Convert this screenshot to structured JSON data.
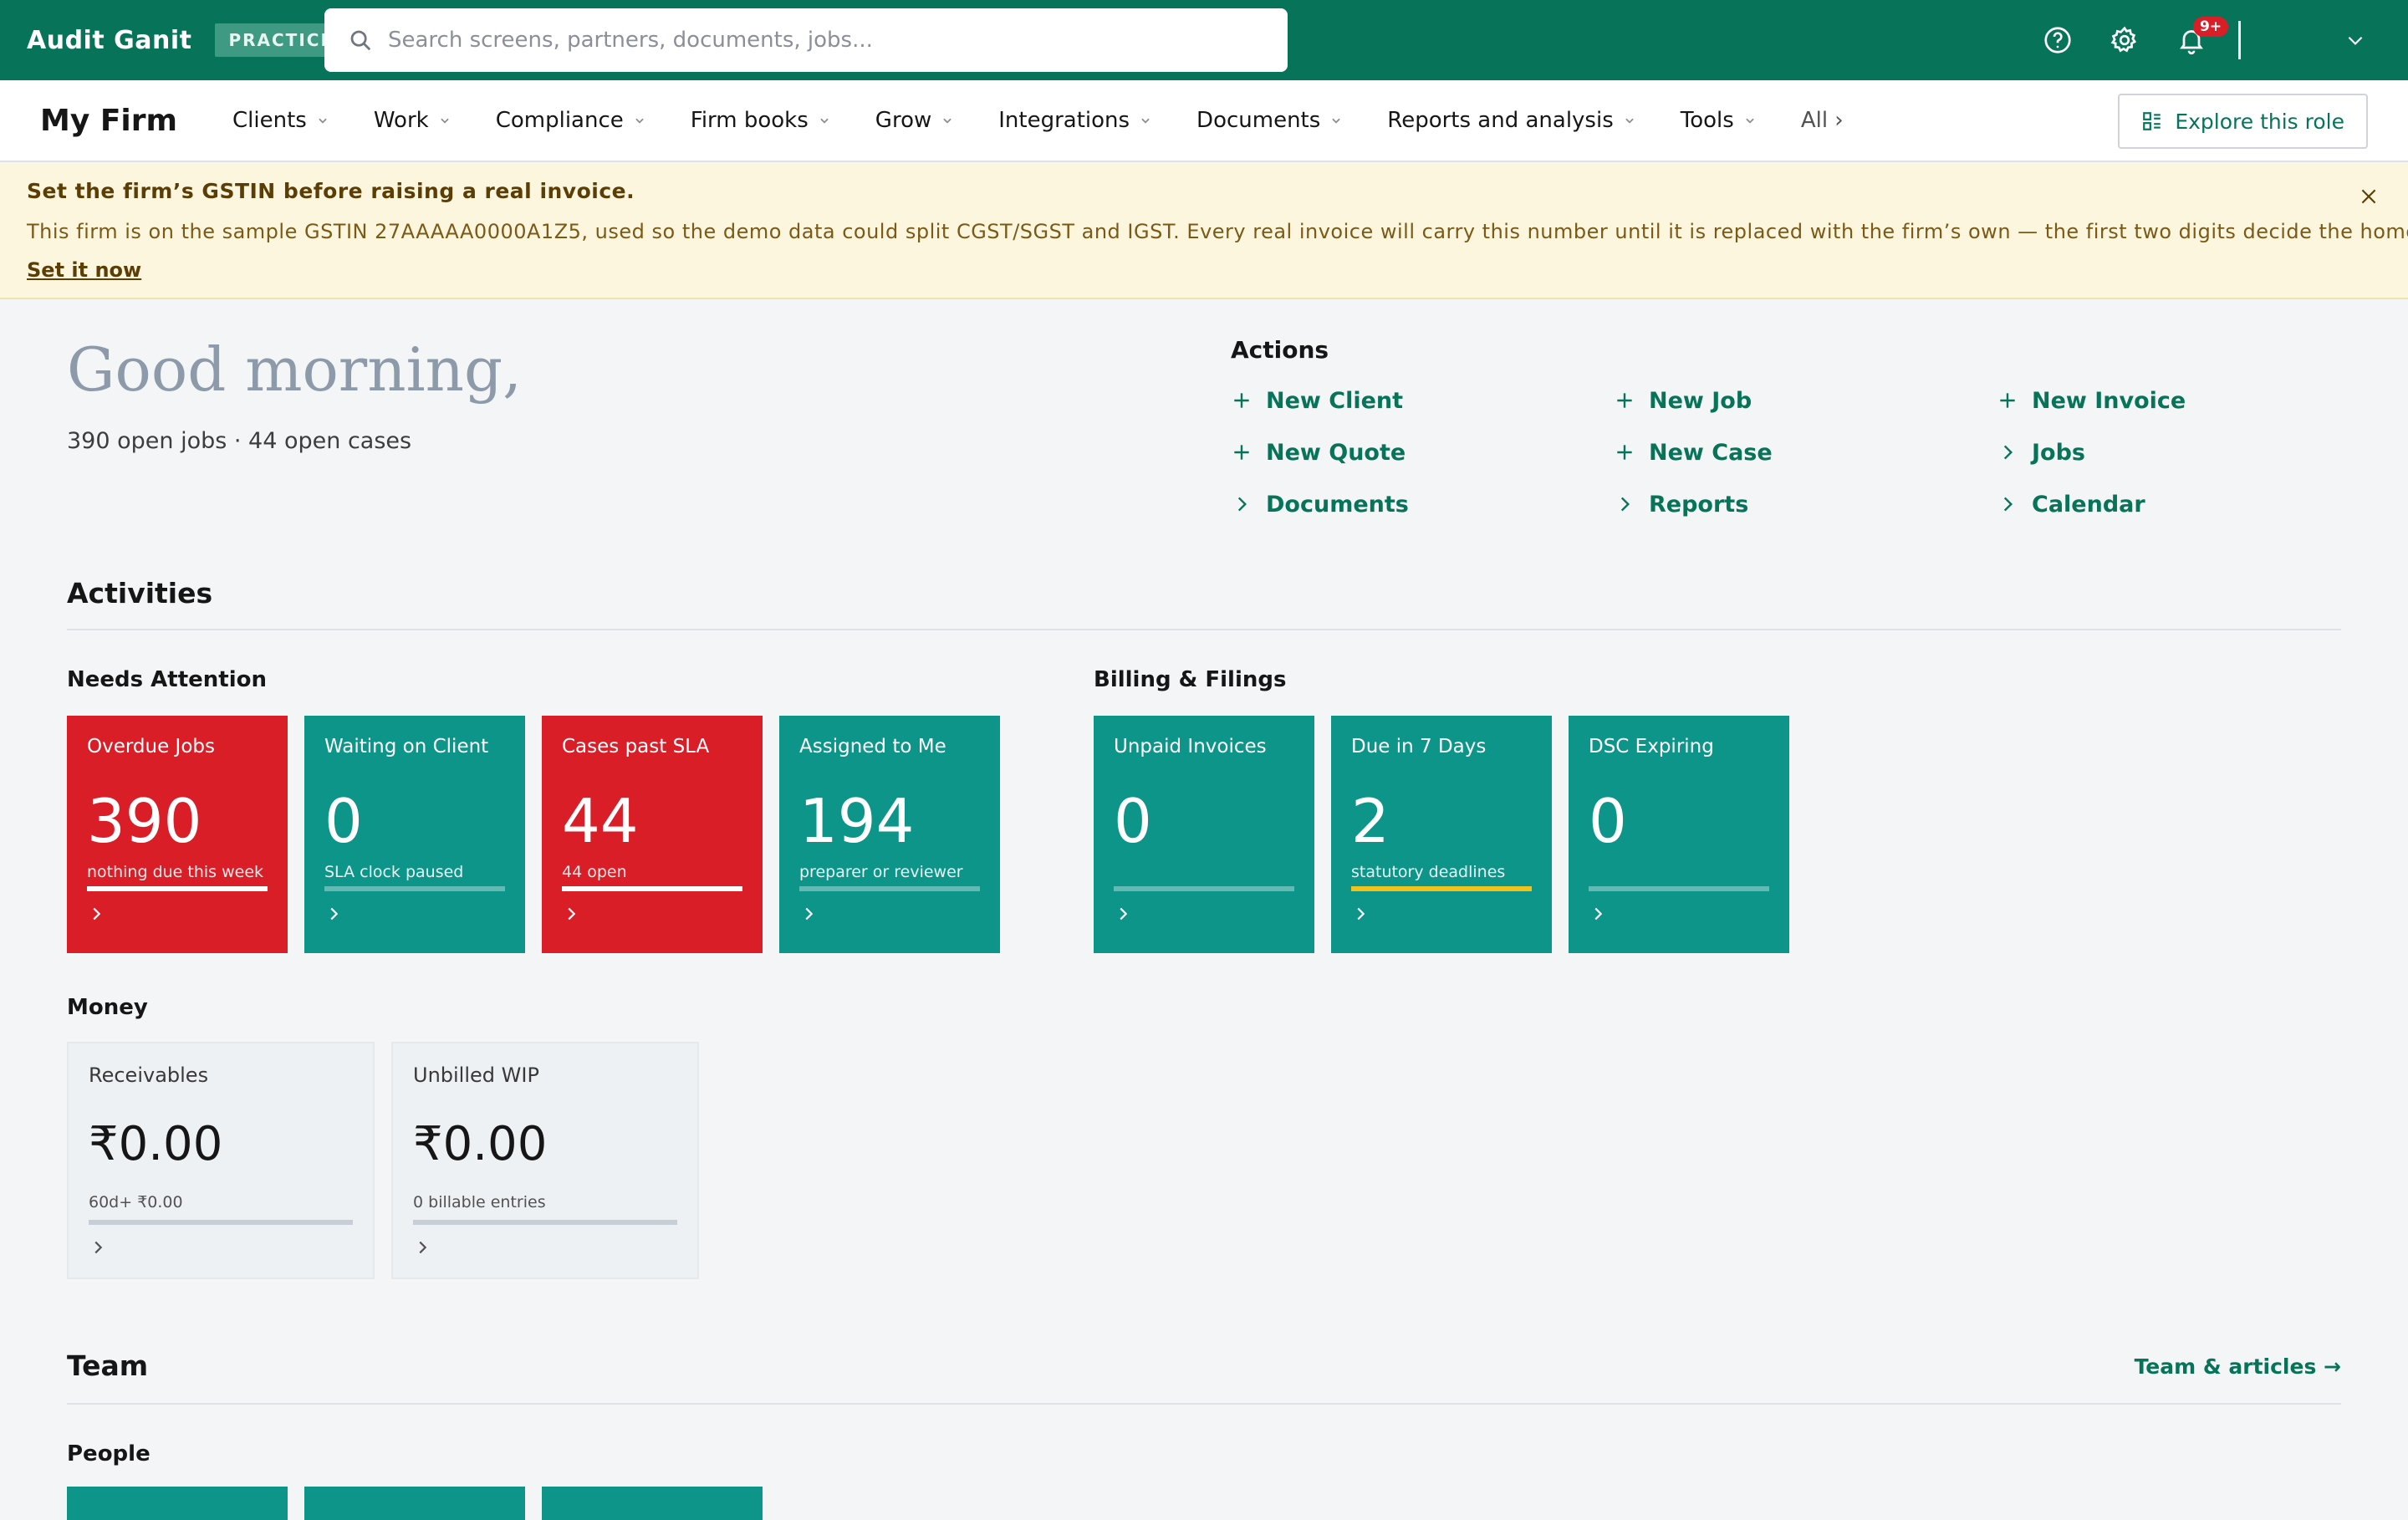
{
  "topbar": {
    "brand": "Audit Ganit",
    "env_badge": "PRACTICE",
    "search_placeholder": "Search screens, partners, documents, jobs...",
    "notification_count": "9+",
    "icons": [
      "search-icon",
      "help-icon",
      "settings-icon",
      "bell-icon",
      "chevron-down-icon"
    ]
  },
  "nav": {
    "firm": "My Firm",
    "items": [
      {
        "label": "Clients"
      },
      {
        "label": "Work"
      },
      {
        "label": "Compliance"
      },
      {
        "label": "Firm books"
      },
      {
        "label": "Grow"
      },
      {
        "label": "Integrations"
      },
      {
        "label": "Documents"
      },
      {
        "label": "Reports and analysis"
      },
      {
        "label": "Tools"
      }
    ],
    "all": "All ›",
    "explore": "Explore this role"
  },
  "banner": {
    "title": "Set the firm’s GSTIN before raising a real invoice.",
    "text": "This firm is on the sample GSTIN 27AAAAA0000A1Z5, used so the demo data could split CGST/SGST and IGST. Every real invoice will carry this number until it is replaced with the firm’s own — the first two digits decide the home state.",
    "link": "Set it now"
  },
  "greeting": {
    "title": "Good morning,",
    "subtitle": "390 open jobs · 44 open cases"
  },
  "actions": {
    "title": "Actions",
    "items": [
      {
        "label": "New Client",
        "icon": "plus-icon"
      },
      {
        "label": "New Job",
        "icon": "plus-icon"
      },
      {
        "label": "New Invoice",
        "icon": "plus-icon"
      },
      {
        "label": "New Quote",
        "icon": "plus-icon"
      },
      {
        "label": "New Case",
        "icon": "plus-icon"
      },
      {
        "label": "Jobs",
        "icon": "chevron-right-icon"
      },
      {
        "label": "Documents",
        "icon": "chevron-right-icon"
      },
      {
        "label": "Reports",
        "icon": "chevron-right-icon"
      },
      {
        "label": "Calendar",
        "icon": "chevron-right-icon"
      }
    ]
  },
  "activities": {
    "title": "Activities",
    "needs_attention": {
      "title": "Needs Attention",
      "tiles": [
        {
          "label": "Overdue Jobs",
          "value": "390",
          "note": "nothing due this week",
          "progress": 1.0,
          "color": "#da1e28"
        },
        {
          "label": "Waiting on Client",
          "value": "0",
          "note": "SLA clock paused",
          "progress": 0.0,
          "color": "#0e958a"
        },
        {
          "label": "Cases past SLA",
          "value": "44",
          "note": "44 open",
          "progress": 1.0,
          "color": "#da1e28"
        },
        {
          "label": "Assigned to Me",
          "value": "194",
          "note": "preparer or reviewer",
          "progress": 0.0,
          "color": "#0e958a"
        }
      ]
    },
    "billing": {
      "title": "Billing & Filings",
      "tiles": [
        {
          "label": "Unpaid Invoices",
          "value": "0",
          "note": "",
          "progress": 0.0,
          "color": "#0e958a"
        },
        {
          "label": "Due in 7 Days",
          "value": "2",
          "note": "statutory deadlines",
          "progress": 1.0,
          "color": "#0e958a",
          "bar_color": "#f1c21b"
        },
        {
          "label": "DSC Expiring",
          "value": "0",
          "note": "",
          "progress": 0.0,
          "color": "#0e958a"
        }
      ]
    },
    "money": {
      "title": "Money",
      "tiles": [
        {
          "label": "Receivables",
          "value": "₹0.00",
          "note": "60d+ ₹0.00"
        },
        {
          "label": "Unbilled WIP",
          "value": "₹0.00",
          "note": "0 billable entries"
        }
      ]
    }
  },
  "team": {
    "title": "Team",
    "link": "Team & articles →",
    "people_title": "People"
  }
}
